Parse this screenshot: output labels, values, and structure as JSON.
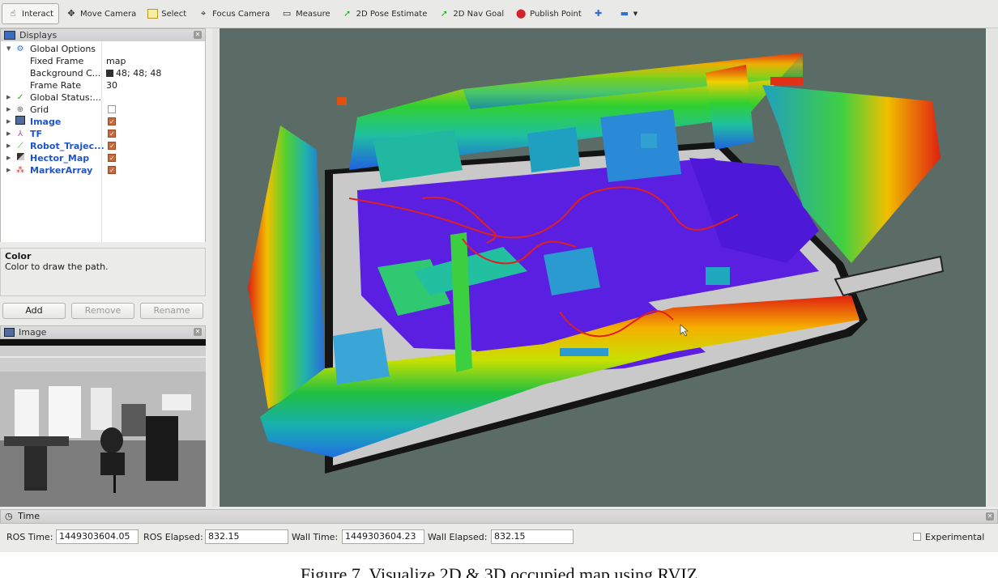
{
  "toolbar": {
    "tools": [
      {
        "label": "Interact",
        "icon": "hand-cursor-icon"
      },
      {
        "label": "Move Camera",
        "icon": "move-camera-icon"
      },
      {
        "label": "Select",
        "icon": "select-box-icon"
      },
      {
        "label": "Focus Camera",
        "icon": "focus-camera-icon"
      },
      {
        "label": "Measure",
        "icon": "ruler-icon"
      },
      {
        "label": "2D Pose Estimate",
        "icon": "green-arrow-icon"
      },
      {
        "label": "2D Nav Goal",
        "icon": "green-arrow-icon"
      },
      {
        "label": "Publish Point",
        "icon": "red-pin-icon"
      }
    ]
  },
  "displays": {
    "title": "Displays",
    "global_options": {
      "label": "Global Options",
      "fixed_frame_label": "Fixed Frame",
      "fixed_frame_value": "map",
      "background_label": "Background C...",
      "background_value": "48; 48; 48",
      "background_color": "#303030",
      "frame_rate_label": "Frame Rate",
      "frame_rate_value": "30"
    },
    "global_status": "Global Status:...",
    "items": [
      {
        "label": "Grid",
        "checked": false,
        "icon": "grid-icon"
      },
      {
        "label": "Image",
        "checked": true,
        "icon": "image-icon"
      },
      {
        "label": "TF",
        "checked": true,
        "icon": "tf-icon"
      },
      {
        "label": "Robot_Trajec...",
        "checked": true,
        "icon": "path-icon"
      },
      {
        "label": "Hector_Map",
        "checked": true,
        "icon": "map-icon"
      },
      {
        "label": "MarkerArray",
        "checked": true,
        "icon": "marker-array-icon"
      }
    ],
    "description_title": "Color",
    "description_text": "Color to draw the path.",
    "add_label": "Add",
    "remove_label": "Remove",
    "rename_label": "Rename"
  },
  "image_panel": {
    "title": "Image"
  },
  "time_panel": {
    "title": "Time",
    "ros_time_label": "ROS Time:",
    "ros_time_value": "1449303604.05",
    "ros_elapsed_label": "ROS Elapsed:",
    "ros_elapsed_value": "832.15",
    "wall_time_label": "Wall Time:",
    "wall_time_value": "1449303604.23",
    "wall_elapsed_label": "Wall Elapsed:",
    "wall_elapsed_value": "832.15",
    "experimental_label": "Experimental"
  },
  "caption": "Figure 7. Visualize 2D & 3D occupied map using RVIZ",
  "colors": {
    "viewport_bg": "#5b6b66",
    "floor": "#5a1fe0",
    "free_space": "#c8c8c8",
    "path": "#e02020"
  }
}
